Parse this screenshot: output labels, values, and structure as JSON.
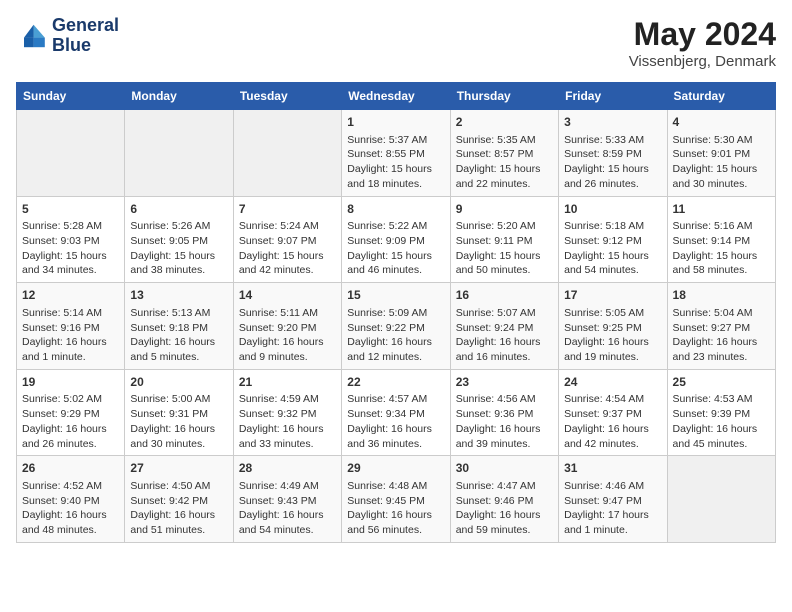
{
  "header": {
    "logo_line1": "General",
    "logo_line2": "Blue",
    "month": "May 2024",
    "location": "Vissenbjerg, Denmark"
  },
  "weekdays": [
    "Sunday",
    "Monday",
    "Tuesday",
    "Wednesday",
    "Thursday",
    "Friday",
    "Saturday"
  ],
  "weeks": [
    [
      {
        "day": "",
        "info": ""
      },
      {
        "day": "",
        "info": ""
      },
      {
        "day": "",
        "info": ""
      },
      {
        "day": "1",
        "info": "Sunrise: 5:37 AM\nSunset: 8:55 PM\nDaylight: 15 hours\nand 18 minutes."
      },
      {
        "day": "2",
        "info": "Sunrise: 5:35 AM\nSunset: 8:57 PM\nDaylight: 15 hours\nand 22 minutes."
      },
      {
        "day": "3",
        "info": "Sunrise: 5:33 AM\nSunset: 8:59 PM\nDaylight: 15 hours\nand 26 minutes."
      },
      {
        "day": "4",
        "info": "Sunrise: 5:30 AM\nSunset: 9:01 PM\nDaylight: 15 hours\nand 30 minutes."
      }
    ],
    [
      {
        "day": "5",
        "info": "Sunrise: 5:28 AM\nSunset: 9:03 PM\nDaylight: 15 hours\nand 34 minutes."
      },
      {
        "day": "6",
        "info": "Sunrise: 5:26 AM\nSunset: 9:05 PM\nDaylight: 15 hours\nand 38 minutes."
      },
      {
        "day": "7",
        "info": "Sunrise: 5:24 AM\nSunset: 9:07 PM\nDaylight: 15 hours\nand 42 minutes."
      },
      {
        "day": "8",
        "info": "Sunrise: 5:22 AM\nSunset: 9:09 PM\nDaylight: 15 hours\nand 46 minutes."
      },
      {
        "day": "9",
        "info": "Sunrise: 5:20 AM\nSunset: 9:11 PM\nDaylight: 15 hours\nand 50 minutes."
      },
      {
        "day": "10",
        "info": "Sunrise: 5:18 AM\nSunset: 9:12 PM\nDaylight: 15 hours\nand 54 minutes."
      },
      {
        "day": "11",
        "info": "Sunrise: 5:16 AM\nSunset: 9:14 PM\nDaylight: 15 hours\nand 58 minutes."
      }
    ],
    [
      {
        "day": "12",
        "info": "Sunrise: 5:14 AM\nSunset: 9:16 PM\nDaylight: 16 hours\nand 1 minute."
      },
      {
        "day": "13",
        "info": "Sunrise: 5:13 AM\nSunset: 9:18 PM\nDaylight: 16 hours\nand 5 minutes."
      },
      {
        "day": "14",
        "info": "Sunrise: 5:11 AM\nSunset: 9:20 PM\nDaylight: 16 hours\nand 9 minutes."
      },
      {
        "day": "15",
        "info": "Sunrise: 5:09 AM\nSunset: 9:22 PM\nDaylight: 16 hours\nand 12 minutes."
      },
      {
        "day": "16",
        "info": "Sunrise: 5:07 AM\nSunset: 9:24 PM\nDaylight: 16 hours\nand 16 minutes."
      },
      {
        "day": "17",
        "info": "Sunrise: 5:05 AM\nSunset: 9:25 PM\nDaylight: 16 hours\nand 19 minutes."
      },
      {
        "day": "18",
        "info": "Sunrise: 5:04 AM\nSunset: 9:27 PM\nDaylight: 16 hours\nand 23 minutes."
      }
    ],
    [
      {
        "day": "19",
        "info": "Sunrise: 5:02 AM\nSunset: 9:29 PM\nDaylight: 16 hours\nand 26 minutes."
      },
      {
        "day": "20",
        "info": "Sunrise: 5:00 AM\nSunset: 9:31 PM\nDaylight: 16 hours\nand 30 minutes."
      },
      {
        "day": "21",
        "info": "Sunrise: 4:59 AM\nSunset: 9:32 PM\nDaylight: 16 hours\nand 33 minutes."
      },
      {
        "day": "22",
        "info": "Sunrise: 4:57 AM\nSunset: 9:34 PM\nDaylight: 16 hours\nand 36 minutes."
      },
      {
        "day": "23",
        "info": "Sunrise: 4:56 AM\nSunset: 9:36 PM\nDaylight: 16 hours\nand 39 minutes."
      },
      {
        "day": "24",
        "info": "Sunrise: 4:54 AM\nSunset: 9:37 PM\nDaylight: 16 hours\nand 42 minutes."
      },
      {
        "day": "25",
        "info": "Sunrise: 4:53 AM\nSunset: 9:39 PM\nDaylight: 16 hours\nand 45 minutes."
      }
    ],
    [
      {
        "day": "26",
        "info": "Sunrise: 4:52 AM\nSunset: 9:40 PM\nDaylight: 16 hours\nand 48 minutes."
      },
      {
        "day": "27",
        "info": "Sunrise: 4:50 AM\nSunset: 9:42 PM\nDaylight: 16 hours\nand 51 minutes."
      },
      {
        "day": "28",
        "info": "Sunrise: 4:49 AM\nSunset: 9:43 PM\nDaylight: 16 hours\nand 54 minutes."
      },
      {
        "day": "29",
        "info": "Sunrise: 4:48 AM\nSunset: 9:45 PM\nDaylight: 16 hours\nand 56 minutes."
      },
      {
        "day": "30",
        "info": "Sunrise: 4:47 AM\nSunset: 9:46 PM\nDaylight: 16 hours\nand 59 minutes."
      },
      {
        "day": "31",
        "info": "Sunrise: 4:46 AM\nSunset: 9:47 PM\nDaylight: 17 hours\nand 1 minute."
      },
      {
        "day": "",
        "info": ""
      }
    ]
  ]
}
